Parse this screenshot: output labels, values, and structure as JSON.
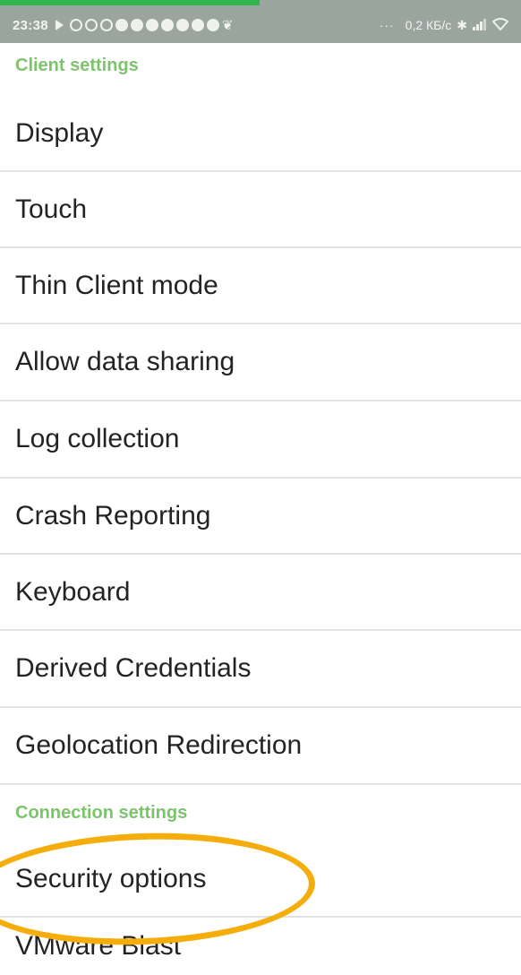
{
  "status_bar": {
    "time": "23:38",
    "more": "···",
    "speed": "0,2 КБ/с",
    "icons": [
      "play-icon",
      "notif-m-icon",
      "notif-m-icon",
      "notif-m-icon",
      "notif-chat-icon",
      "notif-chat-icon",
      "notif-fb-icon",
      "notif-fb-icon",
      "notif-fb-icon",
      "notif-fb-icon",
      "notif-check-icon",
      "notif-flame-icon",
      "bluetooth-icon",
      "signal-icon",
      "wifi-icon"
    ]
  },
  "client_section": {
    "header": "Client settings",
    "items": [
      {
        "label": "Display"
      },
      {
        "label": "Touch"
      },
      {
        "label": "Thin Client mode"
      },
      {
        "label": "Allow data sharing"
      },
      {
        "label": "Log collection"
      },
      {
        "label": "Crash Reporting"
      },
      {
        "label": "Keyboard"
      },
      {
        "label": "Derived Credentials"
      },
      {
        "label": "Geolocation Redirection"
      }
    ]
  },
  "connection_section": {
    "header": "Connection settings",
    "items": [
      {
        "label": "Security options"
      },
      {
        "label": "VMware Blast"
      }
    ]
  },
  "colors": {
    "accent": "#7cc46c",
    "highlight": "#f5ad0b",
    "text": "#232323",
    "status_bar": "#9aa59f"
  }
}
